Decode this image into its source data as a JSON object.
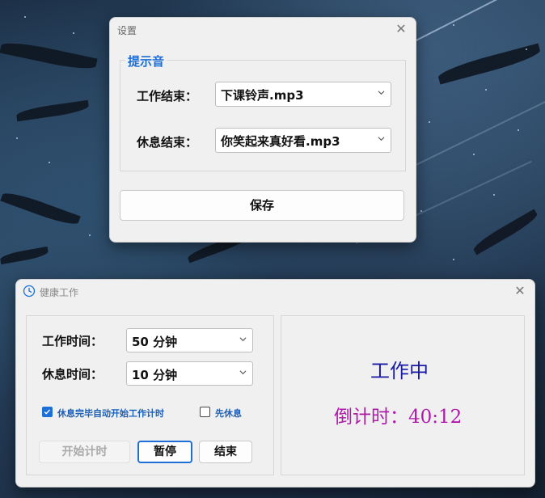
{
  "settings_window": {
    "title": "设置",
    "group_title": "提示音",
    "work_end_label": "工作结束：",
    "work_end_value": "下课铃声.mp3",
    "rest_end_label": "休息结束：",
    "rest_end_value": "你笑起来真好看.mp3",
    "save_label": "保存"
  },
  "health_window": {
    "title": "健康工作",
    "work_time_label": "工作时间：",
    "work_time_value": "50 分钟",
    "rest_time_label": "休息时间：",
    "rest_time_value": "10 分钟",
    "auto_start_label": "休息完毕自动开始工作计时",
    "auto_start_checked": true,
    "rest_first_label": "先休息",
    "rest_first_checked": false,
    "start_label": "开始计时",
    "pause_label": "暂停",
    "end_label": "结束",
    "status": "工作中",
    "countdown_label": "倒计时：",
    "countdown_value": "40:12"
  },
  "colors": {
    "accent_blue": "#1b6fd6",
    "status_blue": "#1a1aa6",
    "countdown_magenta": "#b01aab"
  },
  "icons": [
    "close-icon",
    "chevron-down-icon",
    "clock-icon",
    "checkbox-icon"
  ]
}
